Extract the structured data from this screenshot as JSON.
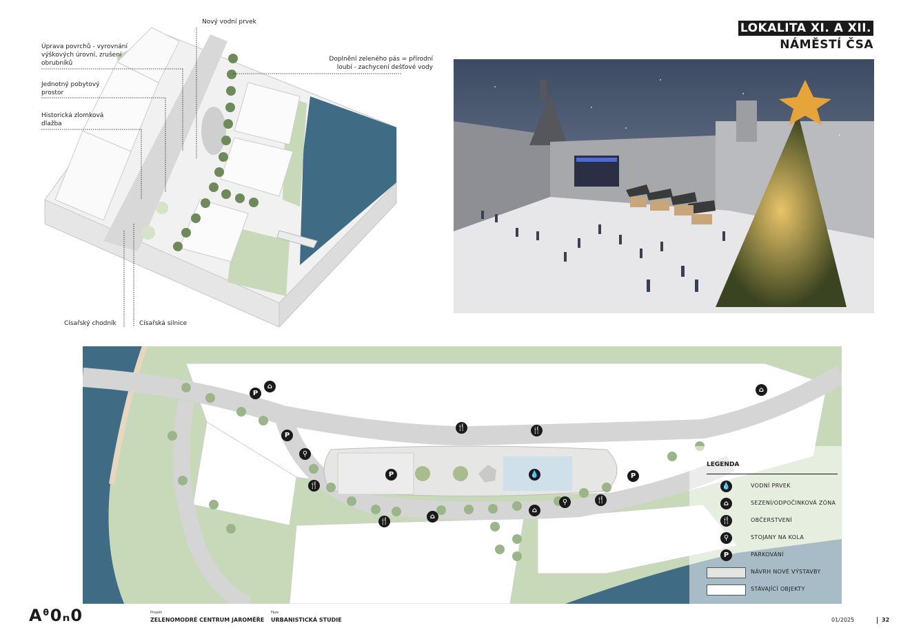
{
  "header": {
    "title_line1": "LOKALITA XI. A XII.",
    "title_line2": "NÁMĚSTÍ ČSA"
  },
  "axo_labels": {
    "water": "Nový vodní prvek",
    "surface": "Úprava povrchů - vyrovnání\nvýškových úrovní, zrušení\nobrubníků",
    "unified": "Jednotný pobytový\nprostor",
    "paving": "Historická zlomková\ndlažba",
    "green": "Doplnění zeleného pás = přírodní\nloubí - zachycení dešťové vody",
    "sidewalk": "Císařský chodník",
    "road": "Císařská silnice"
  },
  "legend": {
    "title": "LEGENDA",
    "items": [
      {
        "icon": "water-drop-icon",
        "glyph": "💧",
        "label": "VODNÍ PRVEK"
      },
      {
        "icon": "bench-icon",
        "glyph": "⌂",
        "label": "SEZENÍ/ODPOČINKOVÁ ZÓNA"
      },
      {
        "icon": "fork-knife-icon",
        "glyph": "🍴",
        "label": "OBČERSTVENÍ"
      },
      {
        "icon": "bicycle-icon",
        "glyph": "⚲",
        "label": "STOJANY NA KOLA"
      },
      {
        "icon": "parking-icon",
        "glyph": "P",
        "label": "PARKOVÁNÍ"
      }
    ],
    "swatches": [
      {
        "color": "#e3e5e3",
        "label": "NÁVRH NOVÉ VÝSTAVBY"
      },
      {
        "color": "#ffffff",
        "label": "STÁVAJÍCÍ OBJEKTY"
      }
    ]
  },
  "footer": {
    "logo": "Aᶿ0ₙ0",
    "project_caption": "Projekt",
    "project": "ZELENOMODRÉ CENTRUM JAROMĚŘE",
    "phase_caption": "Fáze",
    "phase": "URBANISTICKÁ STUDIE",
    "date": "01/2025",
    "page": "32"
  },
  "colors": {
    "water": "#3f6b84",
    "green": "#c7d9b9",
    "tree": "#6f8a5a",
    "accent_dark": "#1a1a1a"
  }
}
